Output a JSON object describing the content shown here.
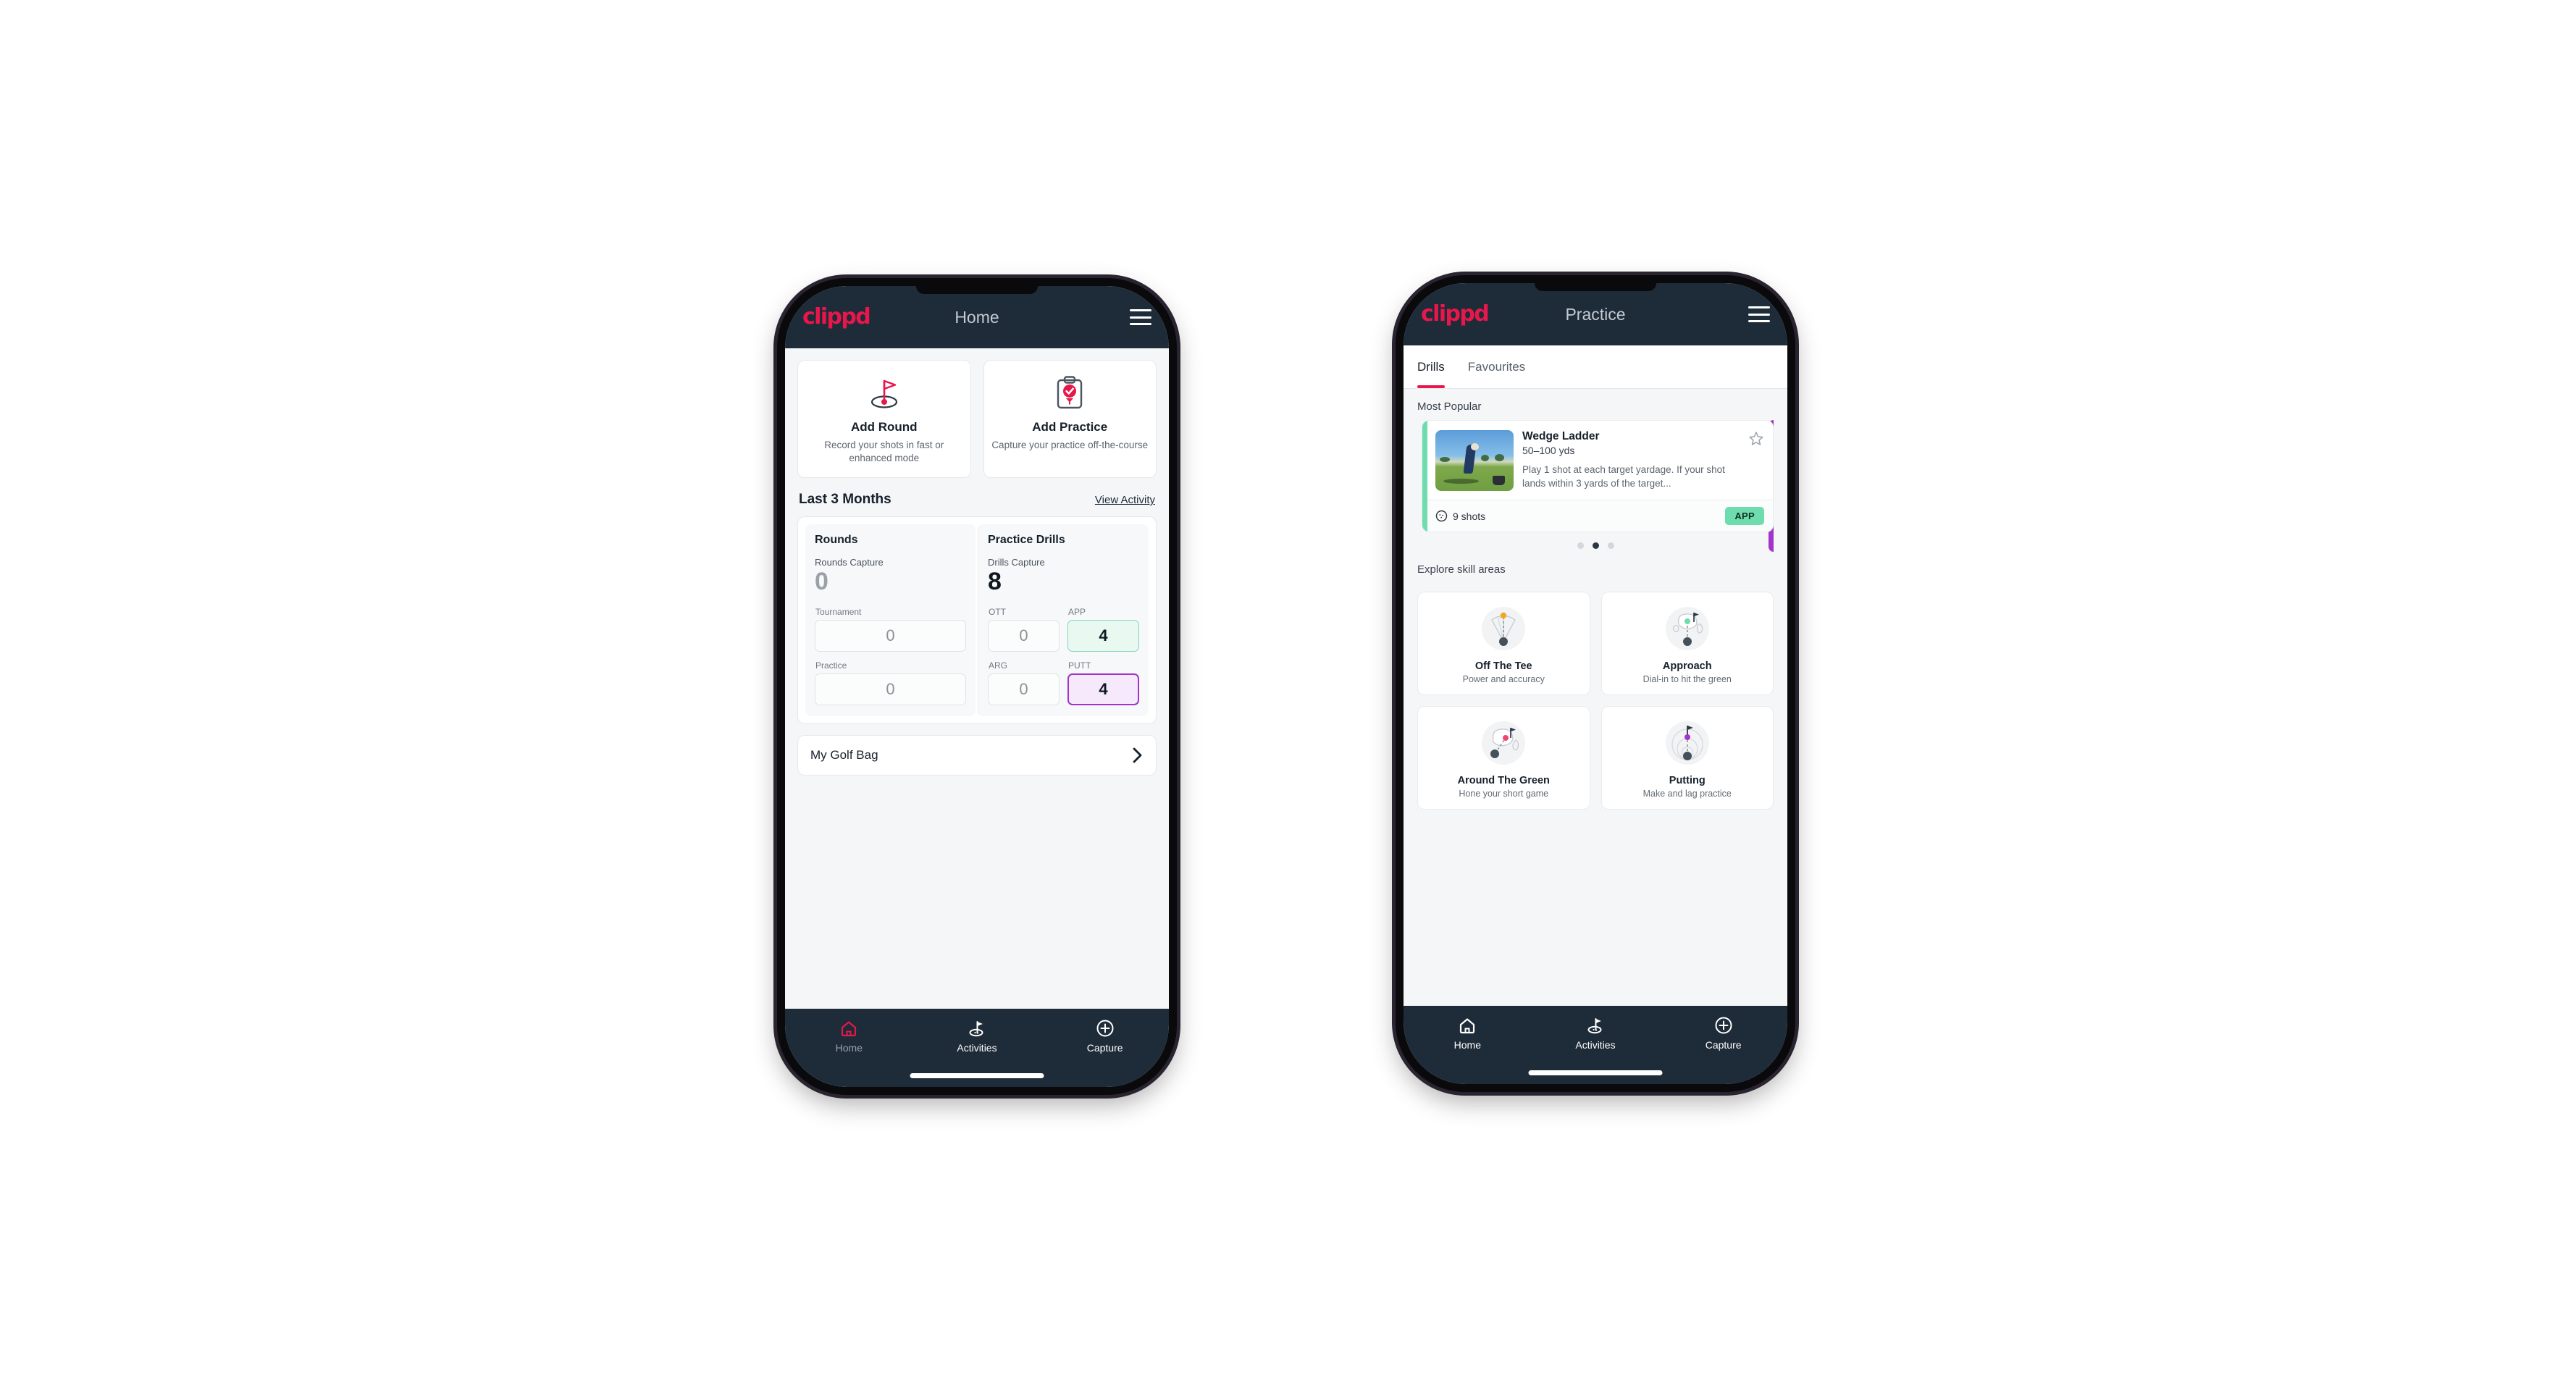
{
  "brand": {
    "logo_text": "clippd",
    "accent_pink": "#e8174b",
    "dark_navy": "#1e2b38",
    "green": "#6fdcae",
    "purple": "#a234c9"
  },
  "home_phone": {
    "appbar": {
      "title": "Home",
      "logo": "clippd",
      "menu_icon": "hamburger-icon"
    },
    "actions": [
      {
        "icon": "golf-flag-hole-icon",
        "title": "Add Round",
        "desc": "Record your shots in fast or enhanced mode"
      },
      {
        "icon": "clipboard-check-icon",
        "title": "Add Practice",
        "desc": "Capture your practice off-the-course"
      }
    ],
    "section": {
      "title": "Last 3 Months",
      "link": "View Activity"
    },
    "stats": {
      "rounds": {
        "heading": "Rounds",
        "capture_label": "Rounds Capture",
        "capture_value": "0",
        "items": [
          {
            "label": "Tournament",
            "value": "0",
            "style": "plain"
          },
          {
            "label": "Practice",
            "value": "0",
            "style": "plain"
          }
        ]
      },
      "drills": {
        "heading": "Practice Drills",
        "capture_label": "Drills Capture",
        "capture_value": "8",
        "items": [
          {
            "label": "OTT",
            "value": "0",
            "style": "plain"
          },
          {
            "label": "APP",
            "value": "4",
            "style": "green"
          },
          {
            "label": "ARG",
            "value": "0",
            "style": "plain"
          },
          {
            "label": "PUTT",
            "value": "4",
            "style": "purple"
          }
        ]
      }
    },
    "golf_bag": {
      "label": "My Golf Bag",
      "chevron": "chevron-right-icon"
    },
    "nav": [
      {
        "icon": "home-icon",
        "label": "Home",
        "active": true
      },
      {
        "icon": "golf-flag-icon",
        "label": "Activities",
        "active": false
      },
      {
        "icon": "plus-circle-icon",
        "label": "Capture",
        "active": false
      }
    ]
  },
  "practice_phone": {
    "appbar": {
      "title": "Practice",
      "logo": "clippd",
      "menu_icon": "hamburger-icon"
    },
    "tabs": [
      {
        "label": "Drills",
        "active": true
      },
      {
        "label": "Favourites",
        "active": false
      }
    ],
    "most_popular_label": "Most Popular",
    "drill": {
      "name": "Wedge Ladder",
      "yardage": "50–100 yds",
      "description": "Play 1 shot at each target yardage. If your shot lands within 3 yards of the target...",
      "shots": "9 shots",
      "shots_icon": "golf-ball-icon",
      "tag": "APP",
      "favourite_icon": "star-outline-icon",
      "accent": "#6fdcae",
      "next_card_accent": "#a234c9",
      "thumbnail": "golfer-hitting-wedge-photo"
    },
    "carousel_dots": {
      "count": 3,
      "active_index": 1
    },
    "skill_section_label": "Explore skill areas",
    "skills": [
      {
        "icon": "tee-shot-dispersion-icon",
        "name": "Off The Tee",
        "desc": "Power and accuracy"
      },
      {
        "icon": "approach-green-icon",
        "name": "Approach",
        "desc": "Dial-in to hit the green"
      },
      {
        "icon": "around-green-icon",
        "name": "Around The Green",
        "desc": "Hone your short game"
      },
      {
        "icon": "putting-rings-icon",
        "name": "Putting",
        "desc": "Make and lag practice"
      }
    ],
    "nav": [
      {
        "icon": "home-icon",
        "label": "Home",
        "active": false
      },
      {
        "icon": "golf-flag-icon",
        "label": "Activities",
        "active": true
      },
      {
        "icon": "plus-circle-icon",
        "label": "Capture",
        "active": false
      }
    ]
  }
}
